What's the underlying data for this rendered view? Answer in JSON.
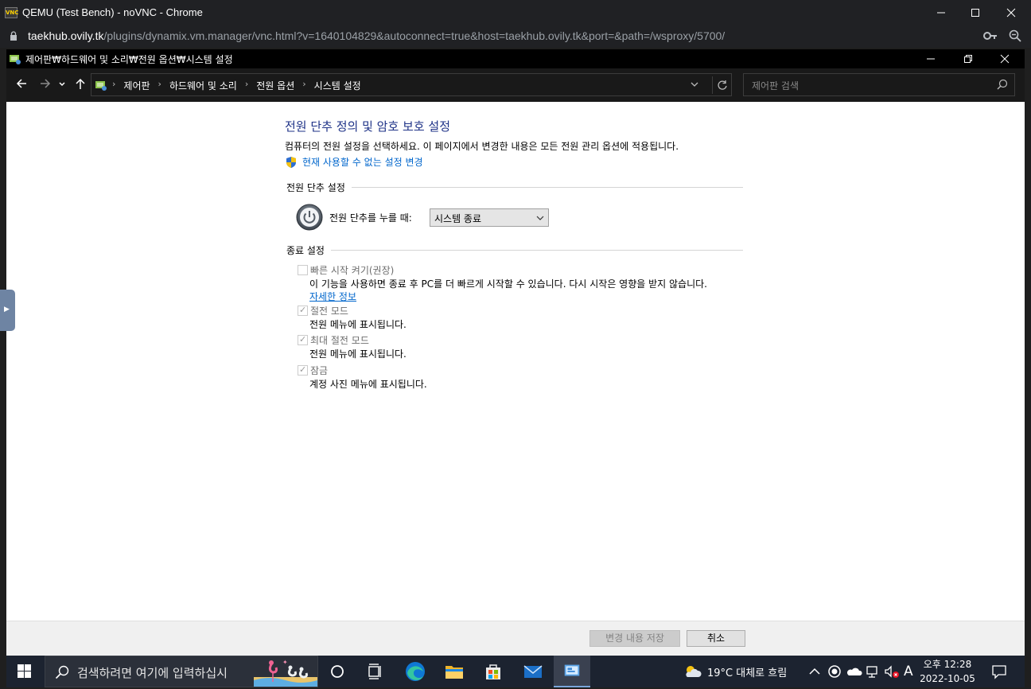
{
  "browser": {
    "title": "QEMU (Test Bench) - noVNC - Chrome",
    "logo_text": "VNC",
    "url_host": "taekhub.ovily.tk",
    "url_path": "/plugins/dynamix.vm.manager/vnc.html?v=1640104829&autoconnect=true&host=taekhub.ovily.tk&port=&path=/wsproxy/5700/"
  },
  "explorer": {
    "title": "제어판₩하드웨어 및 소리₩전원 옵션₩시스템 설정",
    "breadcrumbs": [
      "제어판",
      "하드웨어 및 소리",
      "전원 옵션",
      "시스템 설정"
    ],
    "search_placeholder": "제어판 검색"
  },
  "page": {
    "heading": "전원 단추 정의 및 암호 보호 설정",
    "description": "컴퓨터의 전원 설정을 선택하세요. 이 페이지에서 변경한 내용은 모든 전원 관리 옵션에 적용됩니다.",
    "change_settings_link": "현재 사용할 수 없는 설정 변경",
    "power_section_title": "전원 단추 설정",
    "power_button_label": "전원 단추를 누를 때:",
    "power_button_value": "시스템 종료",
    "shutdown_section_title": "종료 설정",
    "options": [
      {
        "label": "빠른 시작 켜기(권장)",
        "checked": false,
        "desc": "이 기능을 사용하면 종료 후 PC를 더 빠르게 시작할 수 있습니다. 다시 시작은 영향을 받지 않습니다.",
        "link": "자세한 정보"
      },
      {
        "label": "절전 모드",
        "checked": true,
        "desc": "전원 메뉴에 표시됩니다."
      },
      {
        "label": "최대 절전 모드",
        "checked": true,
        "desc": "전원 메뉴에 표시됩니다."
      },
      {
        "label": "잠금",
        "checked": true,
        "desc": "계정 사진 메뉴에 표시됩니다."
      }
    ],
    "save_button": "변경 내용 저장",
    "cancel_button": "취소"
  },
  "taskbar": {
    "search_placeholder": "검색하려면 여기에 입력하십시",
    "weather": "19°C  대체로 흐림",
    "ime": "A",
    "clock_time": "오후 12:28",
    "clock_date": "2022-10-05"
  },
  "colors": {
    "heading": "#1e3287",
    "link": "#0066cc",
    "taskbar": "#1c2330"
  }
}
